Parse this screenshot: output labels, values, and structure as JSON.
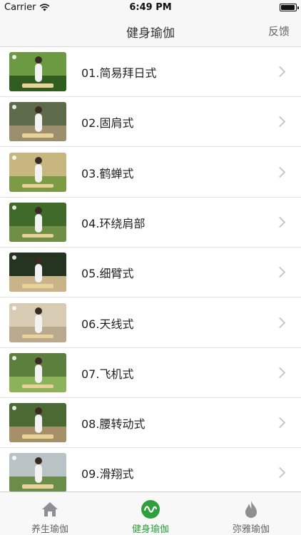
{
  "status_bar": {
    "carrier": "Carrier",
    "time": "6:49 PM",
    "battery_level": 0.95
  },
  "nav": {
    "title": "健身瑜伽",
    "right_button": "反馈"
  },
  "items": [
    {
      "label": "01.简易拜日式",
      "thumb_colors": [
        "#6b9a43",
        "#2f5c1f"
      ]
    },
    {
      "label": "02.固肩式",
      "thumb_colors": [
        "#5e6b4a",
        "#9c8f6e"
      ]
    },
    {
      "label": "03.鹤蝉式",
      "thumb_colors": [
        "#c7b680",
        "#7d9a44"
      ]
    },
    {
      "label": "04.环绕肩部",
      "thumb_colors": [
        "#3f6a2a",
        "#6e8f45"
      ]
    },
    {
      "label": "05.细臂式",
      "thumb_colors": [
        "#243420",
        "#c9b48a"
      ]
    },
    {
      "label": "06.天线式",
      "thumb_colors": [
        "#d8cbb4",
        "#b8a98f"
      ]
    },
    {
      "label": "07.飞机式",
      "thumb_colors": [
        "#5c7f3d",
        "#8db35a"
      ]
    },
    {
      "label": "08.腰转动式",
      "thumb_colors": [
        "#4b6a33",
        "#a69068"
      ]
    },
    {
      "label": "09.滑翔式",
      "thumb_colors": [
        "#b9c3c6",
        "#6b8d4a"
      ]
    }
  ],
  "tabs": [
    {
      "label": "养生瑜伽",
      "icon": "home-icon"
    },
    {
      "label": "健身瑜伽",
      "icon": "pulse-icon",
      "active": true
    },
    {
      "label": "弥雅瑜伽",
      "icon": "flame-icon"
    }
  ],
  "colors": {
    "active_tab": "#2e9f3c",
    "inactive_tab": "#8e8e93"
  }
}
